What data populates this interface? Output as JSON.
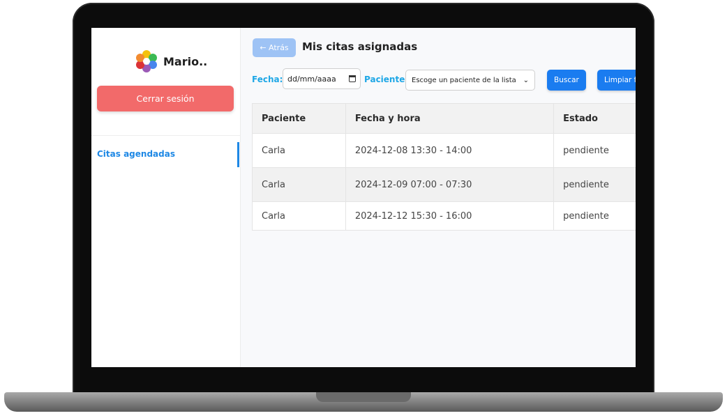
{
  "sidebar": {
    "user_name": "Mario..",
    "logout_label": "Cerrar sesión",
    "nav_items": [
      {
        "label": "Citas agendadas"
      }
    ]
  },
  "header": {
    "back_label": "← Atrás",
    "title": "Mis citas asignadas"
  },
  "filters": {
    "date_label": "Fecha:",
    "date_value": "dd/mm/aaaa",
    "patient_label": "Paciente:",
    "patient_value": "Escoge un paciente de la lista",
    "search_label": "Buscar",
    "clear_label": "Limpiar f"
  },
  "table": {
    "headers": [
      "Paciente",
      "Fecha y hora",
      "Estado"
    ],
    "rows": [
      [
        "Carla",
        "2024-12-08 13:30 - 14:00",
        "pendiente"
      ],
      [
        "Carla",
        "2024-12-09 07:00 - 07:30",
        "pendiente"
      ],
      [
        "Carla",
        "2024-12-12 15:30 - 16:00",
        "pendiente"
      ]
    ]
  },
  "colors": {
    "accent": "#1a7cf0",
    "logout": "#f26a6a",
    "label": "#1ea7e6"
  }
}
